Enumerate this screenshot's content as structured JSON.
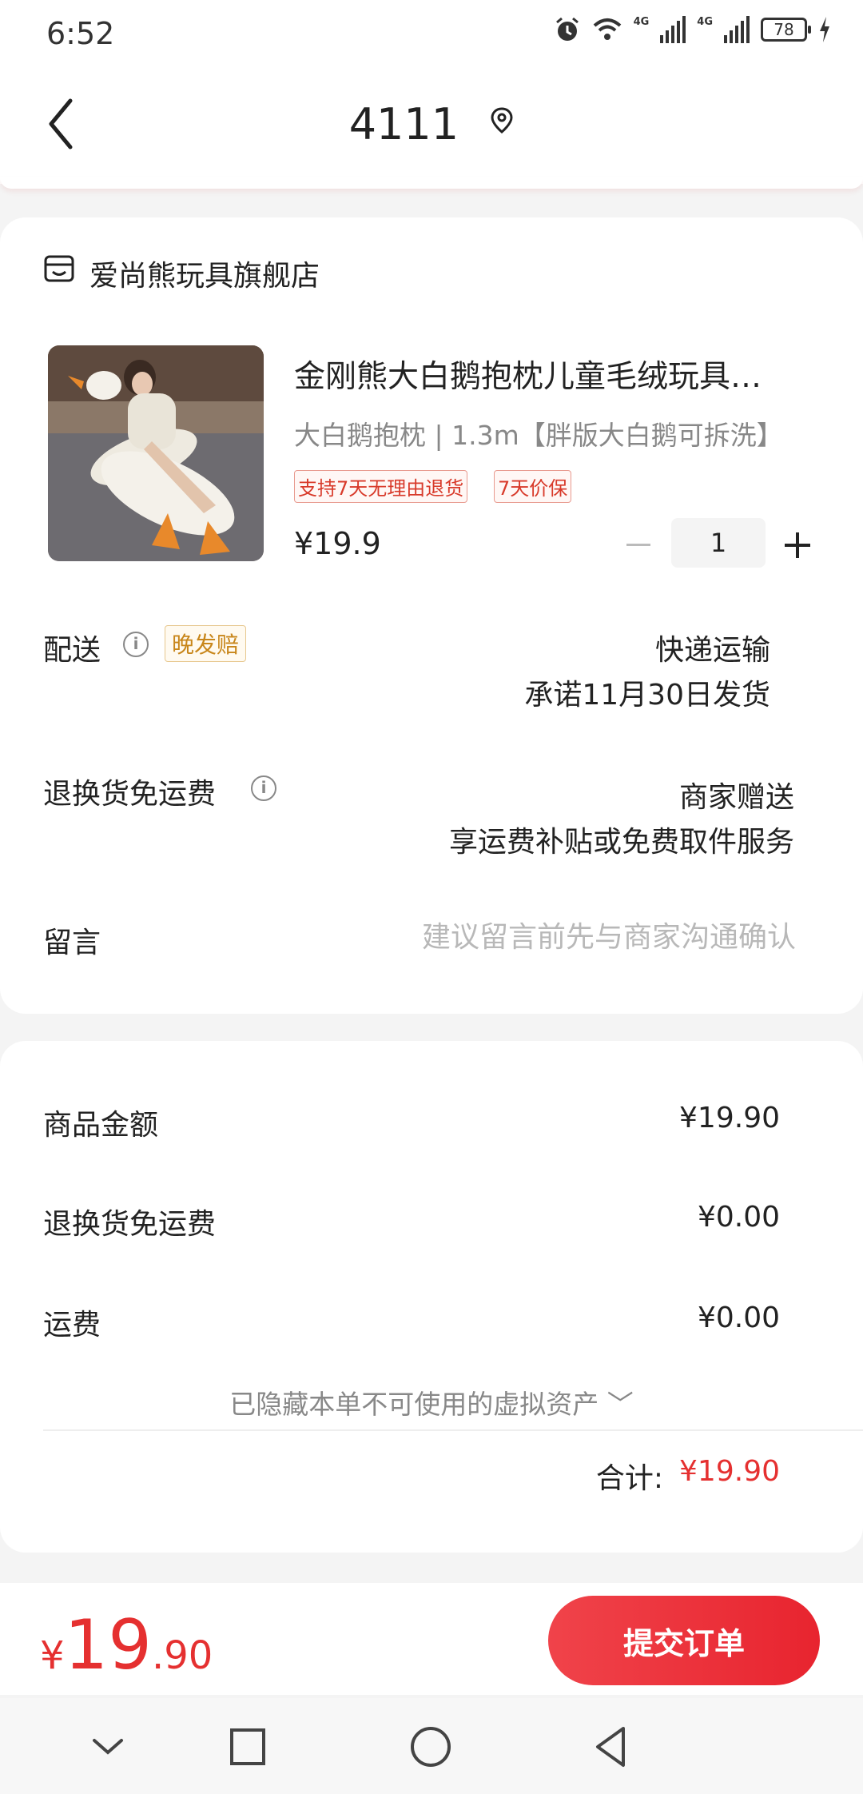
{
  "status_bar": {
    "time": "6:52",
    "network_tag": "4G",
    "battery": "78"
  },
  "header": {
    "title": "4111"
  },
  "store": {
    "name": "爱尚熊玩具旗舰店"
  },
  "product": {
    "title": "金刚熊大白鹅抱枕儿童毛绒玩具…",
    "spec": "大白鹅抱枕 | 1.3m【胖版大白鹅可拆洗】",
    "badges": [
      "支持7天无理由退货",
      "7天价保"
    ],
    "price": "¥19.9",
    "quantity": "1"
  },
  "delivery": {
    "label": "配送",
    "badge": "晚发赔",
    "method": "快递运输",
    "promise": "承诺11月30日发货"
  },
  "return_shipping": {
    "label": "退换货免运费",
    "value": "商家赠送",
    "desc": "享运费补贴或免费取件服务"
  },
  "message": {
    "label": "留言",
    "placeholder": "建议留言前先与商家沟通确认"
  },
  "summary": {
    "rows": [
      {
        "label": "商品金额",
        "value": "¥19.90"
      },
      {
        "label": "退换货免运费",
        "value": "¥0.00"
      },
      {
        "label": "运费",
        "value": "¥0.00"
      }
    ],
    "hidden_assets": "已隐藏本单不可使用的虚拟资产 ﹀",
    "total_label": "合计:",
    "total_value": "¥19.90"
  },
  "bottom": {
    "currency": "¥",
    "price_int": "19",
    "price_dec": ".90",
    "submit_label": "提交订单"
  },
  "colors": {
    "accent": "#e53030",
    "late_badge": "#c8861a"
  }
}
